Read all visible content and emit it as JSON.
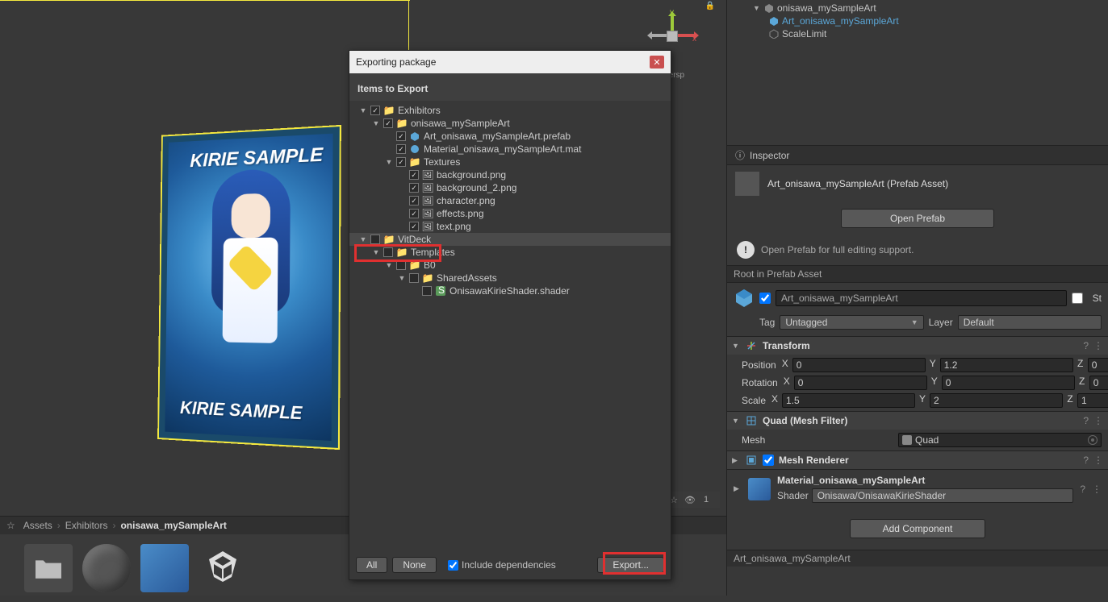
{
  "hierarchy": {
    "root": "onisawa_mySampleArt",
    "child1": "Art_onisawa_mySampleArt",
    "child2": "ScaleLimit"
  },
  "gizmo": {
    "x": "x",
    "y": "y",
    "persp": "Persp"
  },
  "card": {
    "top_text": "KIRIE SAMPLE",
    "bottom_text": "KIRIE SAMPLE"
  },
  "scene_toolbar": {
    "visibility_count": "1"
  },
  "breadcrumb": {
    "root": "Assets",
    "l1": "Exhibitors",
    "l2": "onisawa_mySampleArt"
  },
  "inspector": {
    "tab": "Inspector",
    "header_title": "Art_onisawa_mySampleArt (Prefab Asset)",
    "open_prefab": "Open Prefab",
    "open_prefab_hint": "Open Prefab for full editing support.",
    "root_label": "Root in Prefab Asset",
    "name": "Art_onisawa_mySampleArt",
    "static": "St",
    "tag_label": "Tag",
    "tag_value": "Untagged",
    "layer_label": "Layer",
    "layer_value": "Default",
    "transform": {
      "title": "Transform",
      "position": {
        "label": "Position",
        "x": "0",
        "y": "1.2",
        "z": "0"
      },
      "rotation": {
        "label": "Rotation",
        "x": "0",
        "y": "0",
        "z": "0"
      },
      "scale": {
        "label": "Scale",
        "x": "1.5",
        "y": "2",
        "z": "1"
      }
    },
    "meshfilter": {
      "title": "Quad (Mesh Filter)",
      "mesh_label": "Mesh",
      "mesh_value": "Quad"
    },
    "meshrenderer": {
      "title": "Mesh Renderer"
    },
    "material": {
      "name": "Material_onisawa_mySampleArt",
      "shader_label": "Shader",
      "shader_value": "Onisawa/OnisawaKirieShader"
    },
    "add_component": "Add Component",
    "footer": "Art_onisawa_mySampleArt"
  },
  "dialog": {
    "title": "Exporting package",
    "subtitle": "Items to Export",
    "tree": {
      "exhibitors": "Exhibitors",
      "sample": "onisawa_mySampleArt",
      "prefab": "Art_onisawa_mySampleArt.prefab",
      "material": "Material_onisawa_mySampleArt.mat",
      "textures": "Textures",
      "bg1": "background.png",
      "bg2": "background_2.png",
      "char": "character.png",
      "fx": "effects.png",
      "text": "text.png",
      "vitdeck": "VitDeck",
      "templates": "Templates",
      "b0": "B0",
      "shared": "SharedAssets",
      "shader": "OnisawaKirieShader.shader"
    },
    "buttons": {
      "all": "All",
      "none": "None",
      "export": "Export...",
      "include": "Include dependencies"
    }
  }
}
